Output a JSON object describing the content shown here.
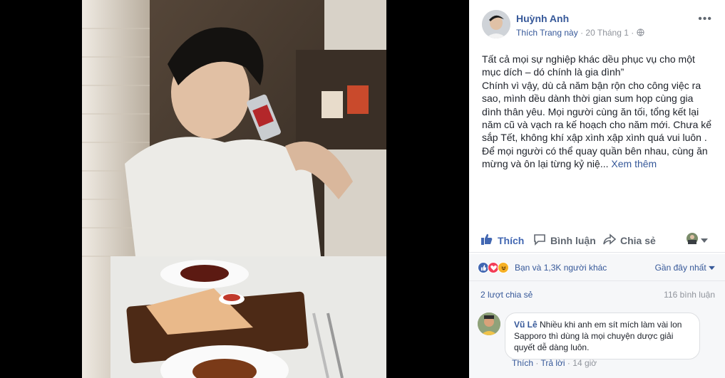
{
  "post": {
    "author": "Huỳnh Anh",
    "like_page": "Thích Trang này",
    "date": "20 Tháng 1",
    "separator": "·",
    "text_lines": [
      "Tất cả mọi sự nghiệp khác dều phục vụ cho một mục dích – dó chính là gia dình”",
      "Chính vì vậy, dù cả năm bận rộn cho công việc ra sao, mình dều dành thời gian sum họp cùng gia dình thân yêu. Mọi người cùng ăn tối, tổng kết lại năm cũ và vạch ra kế hoạch cho năm mới. Chưa kể sắp Tết, không khí xập xình xập xình quá vui luôn .",
      "Để mọi người có thể quay quần bên nhau, cùng ăn mừng và ôn lại từng kỷ niệ..."
    ],
    "see_more": "Xem thêm",
    "more_icon": "•••"
  },
  "actions": {
    "like": "Thích",
    "comment": "Bình luận",
    "share": "Chia sẻ"
  },
  "reactions": {
    "summary": "Bạn và 1,3K người khác",
    "sort": "Gần đây nhất"
  },
  "counts": {
    "shares": "2 lượt chia sẻ",
    "comments": "116 bình luận"
  },
  "comment": {
    "author": "Vũ Lê",
    "text": "Nhiều khi anh em sít mích làm vài lon Sapporo thì dùng là mọi chuyện dược giải quyết dễ dàng luôn.",
    "like": "Thích",
    "reply": "Trả lời",
    "time": "14 giờ",
    "dot": "·"
  },
  "colors": {
    "link": "#365899",
    "like_blue": "#4267b2",
    "muted": "#90949c"
  }
}
